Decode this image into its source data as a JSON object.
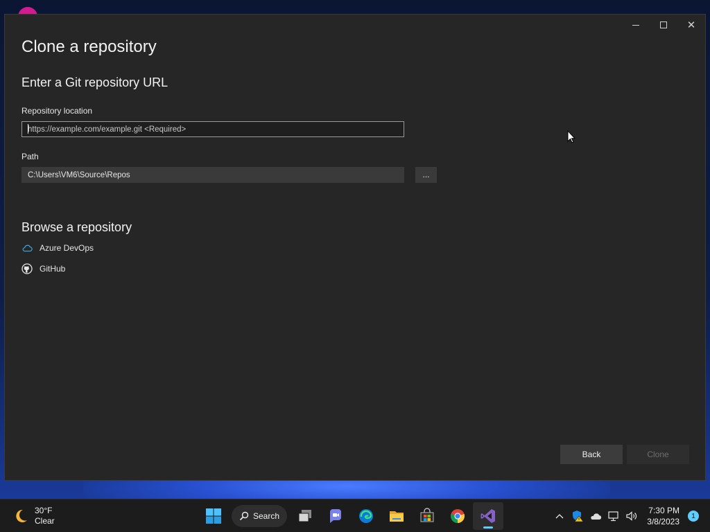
{
  "dialog": {
    "title": "Clone a repository",
    "subtitle": "Enter a Git repository URL",
    "repo_label": "Repository location",
    "repo_placeholder": "https://example.com/example.git <Required>",
    "repo_value": "",
    "path_label": "Path",
    "path_value": "C:\\Users\\VM6\\Source\\Repos",
    "browse_button": "...",
    "browse_heading": "Browse a repository",
    "providers": [
      {
        "label": "Azure DevOps",
        "icon": "cloud-icon"
      },
      {
        "label": "GitHub",
        "icon": "github-icon"
      }
    ],
    "back_button": "Back",
    "clone_button": "Clone"
  },
  "taskbar": {
    "weather": {
      "temp": "30°F",
      "condition": "Clear",
      "icon": "moon-icon"
    },
    "search_label": "Search",
    "apps": [
      "start",
      "search",
      "task-view",
      "teams-chat",
      "edge",
      "file-explorer",
      "microsoft-store",
      "chrome",
      "visual-studio"
    ],
    "active_app": "visual-studio",
    "clock": {
      "time": "7:30 PM",
      "date": "3/8/2023"
    },
    "notification_count": "1"
  },
  "colors": {
    "window_bg": "#262626",
    "accent": "#60cdff",
    "azure_icon": "#3ba7d8"
  }
}
